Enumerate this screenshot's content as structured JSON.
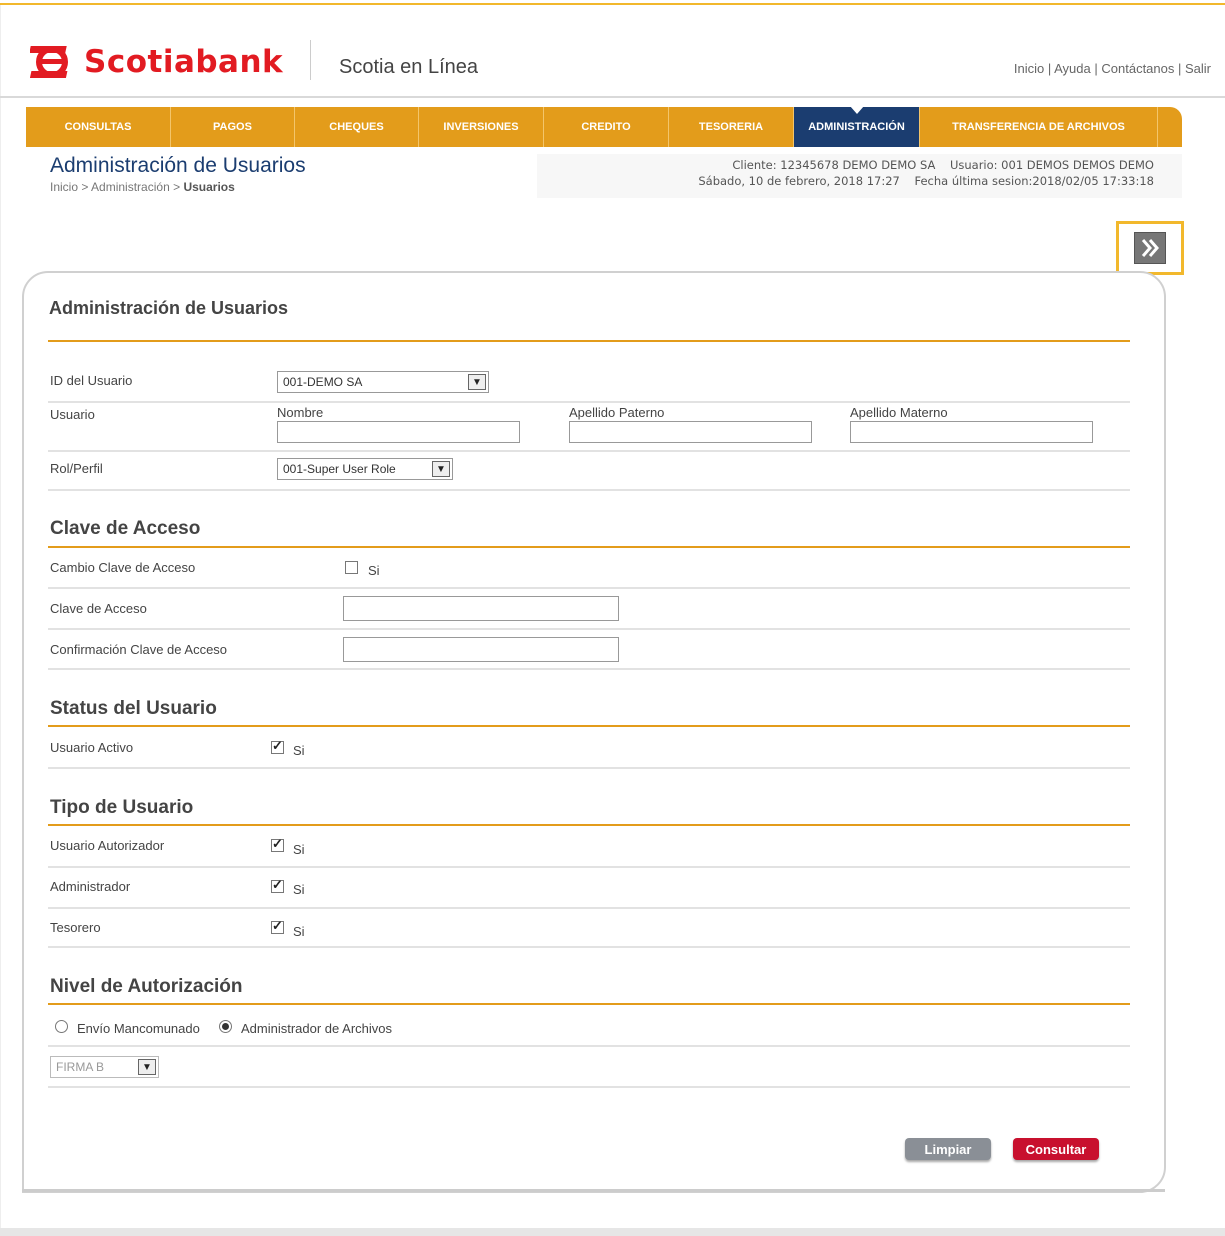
{
  "brand": {
    "name": "Scotiabank",
    "product": "Scotia en Línea",
    "accent_color": "#e21b22",
    "nav_color": "#e39c1b",
    "active_nav_color": "#1b3d70"
  },
  "top_links": [
    "Inicio",
    "Ayuda",
    "Contáctanos",
    "Salir"
  ],
  "nav": {
    "items": [
      {
        "label": "CONSULTAS"
      },
      {
        "label": "PAGOS"
      },
      {
        "label": "CHEQUES"
      },
      {
        "label": "INVERSIONES"
      },
      {
        "label": "CREDITO"
      },
      {
        "label": "TESORERIA"
      },
      {
        "label": "ADMINISTRACIÓN",
        "active": true
      },
      {
        "label": "TRANSFERENCIA DE ARCHIVOS"
      }
    ]
  },
  "page": {
    "title": "Administración de Usuarios",
    "breadcrumb": {
      "home": "Inicio",
      "section": "Administración",
      "current": "Usuarios",
      "sep": ">"
    }
  },
  "client_info": {
    "line1": "Cliente: 12345678 DEMO DEMO SA    Usuario: 001 DEMOS DEMOS DEMO",
    "line2": "Sábado, 10 de febrero, 2018 17:27    Fecha última sesion:2018/02/05 17:33:18"
  },
  "toolbar": {
    "next_icon": "double-chevron-right-icon"
  },
  "form": {
    "title": "Administración de Usuarios",
    "user_id": {
      "label": "ID del Usuario",
      "value": "001-DEMO SA"
    },
    "user": {
      "label": "Usuario",
      "nombre_label": "Nombre",
      "nombre_value": "",
      "paterno_label": "Apellido Paterno",
      "paterno_value": "",
      "materno_label": "Apellido Materno",
      "materno_value": ""
    },
    "role": {
      "label": "Rol/Perfil",
      "value": "001-Super User Role"
    },
    "access": {
      "title": "Clave de Acceso",
      "change_label": "Cambio Clave de Acceso",
      "change_check": "Si",
      "change_checked": false,
      "password_label": "Clave de Acceso",
      "password_value": "",
      "confirm_label": "Confirmación Clave de Acceso",
      "confirm_value": ""
    },
    "status": {
      "title": "Status del Usuario",
      "active_label": "Usuario Activo",
      "active_check": "Si",
      "active_checked": true
    },
    "type": {
      "title": "Tipo de Usuario",
      "authorizer_label": "Usuario Autorizador",
      "authorizer_check": "Si",
      "authorizer_checked": true,
      "admin_label": "Administrador",
      "admin_check": "Si",
      "admin_checked": true,
      "treasurer_label": "Tesorero",
      "treasurer_check": "Si",
      "treasurer_checked": true
    },
    "auth_level": {
      "title": "Nivel de Autorización",
      "option1": "Envío Mancomunado",
      "option1_selected": false,
      "option2": "Administrador de Archivos",
      "option2_selected": true,
      "firma_value": "FIRMA B"
    },
    "buttons": {
      "clear": "Limpiar",
      "submit": "Consultar"
    }
  }
}
